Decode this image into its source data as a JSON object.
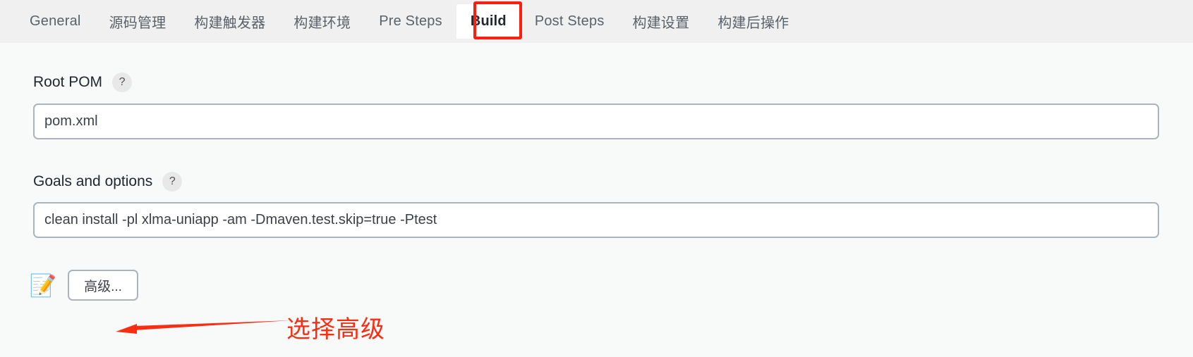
{
  "window": {
    "background": "#f8f9f9",
    "tabbar_background": "#f0f0f0"
  },
  "tabs": {
    "items": [
      {
        "label": "General",
        "active": false,
        "cjk": false
      },
      {
        "label": "源码管理",
        "active": false,
        "cjk": true
      },
      {
        "label": "构建触发器",
        "active": false,
        "cjk": true
      },
      {
        "label": "构建环境",
        "active": false,
        "cjk": true
      },
      {
        "label": "Pre Steps",
        "active": false,
        "cjk": false
      },
      {
        "label": "Build",
        "active": true,
        "cjk": false
      },
      {
        "label": "Post Steps",
        "active": false,
        "cjk": false
      },
      {
        "label": "构建设置",
        "active": false,
        "cjk": true
      },
      {
        "label": "构建后操作",
        "active": false,
        "cjk": true
      }
    ],
    "highlight_color": "#fc1f0d"
  },
  "form": {
    "root_pom": {
      "label": "Root POM",
      "help": "?",
      "value": "pom.xml",
      "placeholder": "pom.xml"
    },
    "goals": {
      "label": "Goals and options",
      "help": "?",
      "value": "clean install -pl xlma-uniapp -am -Dmaven.test.skip=true -Ptest",
      "placeholder": ""
    }
  },
  "bottom": {
    "memo_icon": "📝",
    "advanced_button": "高级..."
  },
  "annotation": {
    "text": "选择高级",
    "color": "#fa2d12"
  }
}
